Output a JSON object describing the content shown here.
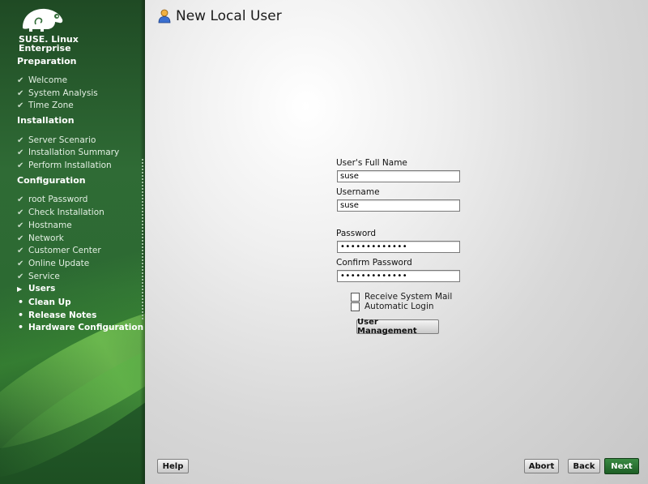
{
  "brand": {
    "line1": "SUSE. Linux",
    "line2": "Enterprise"
  },
  "sidebar": {
    "sections": [
      {
        "title": "Preparation",
        "steps": [
          "Welcome",
          "System Analysis",
          "Time Zone"
        ]
      },
      {
        "title": "Installation",
        "steps": [
          "Server Scenario",
          "Installation Summary",
          "Perform Installation"
        ]
      },
      {
        "title": "Configuration",
        "steps": [
          "root Password",
          "Check Installation",
          "Hostname",
          "Network",
          "Customer Center",
          "Online Update",
          "Service",
          "Users",
          "Clean Up",
          "Release Notes",
          "Hardware Configuration"
        ]
      }
    ],
    "current_step": "Users"
  },
  "main": {
    "title": "New Local User",
    "full_name_label": "User's Full Name",
    "full_name_value": "suse",
    "username_label": "Username",
    "username_value": "suse",
    "password_label": "Password",
    "password_value": "•••••••••••••",
    "confirm_label": "Confirm Password",
    "confirm_value": "•••••••••••••",
    "receive_mail_label": "Receive System Mail",
    "receive_mail_checked": false,
    "auto_login_label": "Automatic Login",
    "auto_login_checked": false,
    "user_mgmt_label": "User Management"
  },
  "buttons": {
    "help": "Help",
    "abort": "Abort",
    "back": "Back",
    "next": "Next"
  },
  "colors": {
    "sidebar_green": "#2f6b35",
    "next_green": "#1d5e25"
  },
  "icons": {
    "logo": "suse-chameleon-logo",
    "title": "user-icon",
    "done": "check-icon",
    "current": "triangle-right-icon",
    "pending": "bullet-icon"
  }
}
